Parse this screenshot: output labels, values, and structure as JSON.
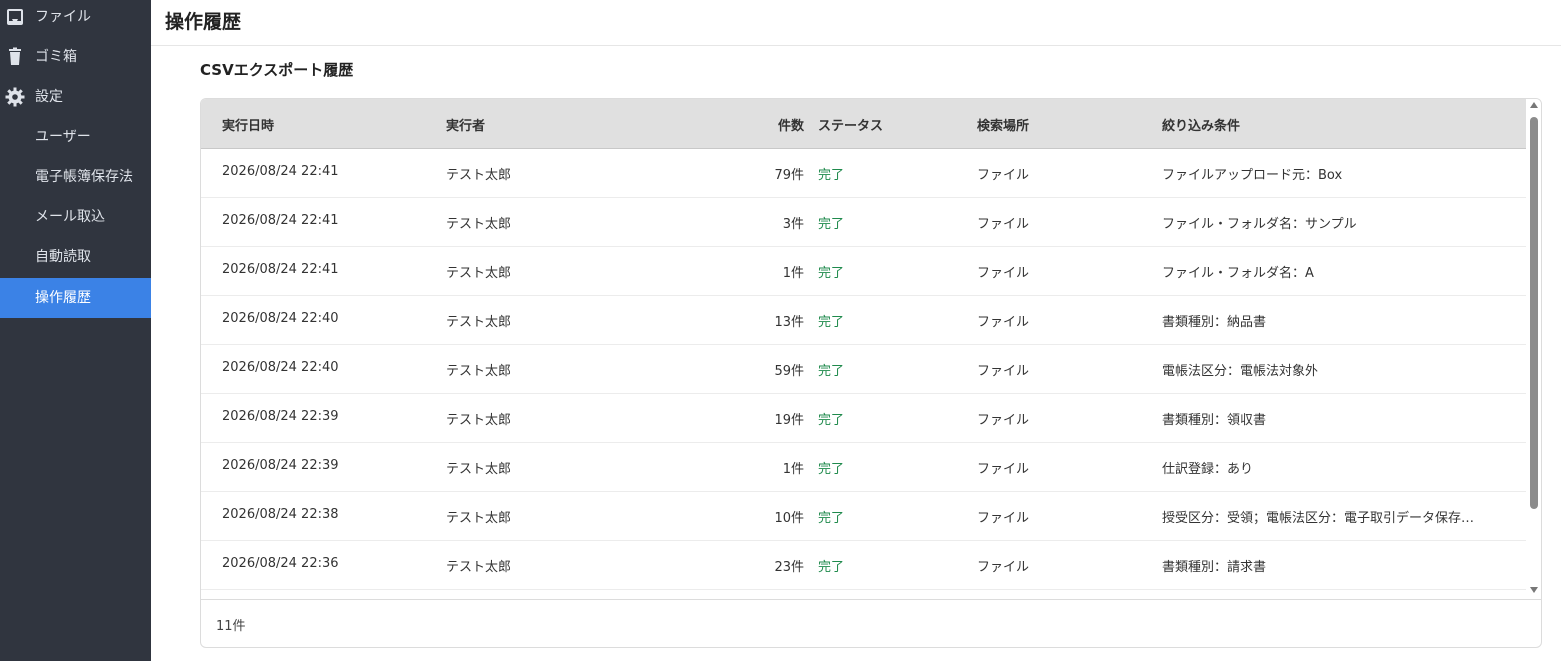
{
  "sidebar": {
    "items": [
      {
        "label": "ファイル",
        "icon": "inbox-icon"
      },
      {
        "label": "ゴミ箱",
        "icon": "trash-icon"
      },
      {
        "label": "設定",
        "icon": "gear-icon"
      },
      {
        "label": "ユーザー"
      },
      {
        "label": "電子帳簿保存法"
      },
      {
        "label": "メール取込"
      },
      {
        "label": "自動読取"
      },
      {
        "label": "操作履歴",
        "active": true
      }
    ],
    "active_color": "#3b82e6",
    "background": "#30353f"
  },
  "header": {
    "title": "操作履歴"
  },
  "main": {
    "section_title": "CSVエクスポート履歴",
    "table": {
      "columns": [
        "実行日時",
        "実行者",
        "件数",
        "ステータス",
        "検索場所",
        "絞り込み条件"
      ],
      "rows": [
        {
          "date": "2026/08/24 22:41",
          "user": "テスト太郎",
          "count": "79件",
          "status": "完了",
          "location": "ファイル",
          "condition": "ファイルアップロード元：Box"
        },
        {
          "date": "2026/08/24 22:41",
          "user": "テスト太郎",
          "count": "3件",
          "status": "完了",
          "location": "ファイル",
          "condition": "ファイル・フォルダ名：サンプル"
        },
        {
          "date": "2026/08/24 22:41",
          "user": "テスト太郎",
          "count": "1件",
          "status": "完了",
          "location": "ファイル",
          "condition": "ファイル・フォルダ名：A"
        },
        {
          "date": "2026/08/24 22:40",
          "user": "テスト太郎",
          "count": "13件",
          "status": "完了",
          "location": "ファイル",
          "condition": "書類種別：納品書"
        },
        {
          "date": "2026/08/24 22:40",
          "user": "テスト太郎",
          "count": "59件",
          "status": "完了",
          "location": "ファイル",
          "condition": "電帳法区分：電帳法対象外"
        },
        {
          "date": "2026/08/24 22:39",
          "user": "テスト太郎",
          "count": "19件",
          "status": "完了",
          "location": "ファイル",
          "condition": "書類種別：領収書"
        },
        {
          "date": "2026/08/24 22:39",
          "user": "テスト太郎",
          "count": "1件",
          "status": "完了",
          "location": "ファイル",
          "condition": "仕訳登録：あり"
        },
        {
          "date": "2026/08/24 22:38",
          "user": "テスト太郎",
          "count": "10件",
          "status": "完了",
          "location": "ファイル",
          "condition": "授受区分：受領；電帳法区分：電子取引データ保存…"
        },
        {
          "date": "2026/08/24 22:36",
          "user": "テスト太郎",
          "count": "23件",
          "status": "完了",
          "location": "ファイル",
          "condition": "書類種別：請求書"
        }
      ],
      "total": "11件",
      "status_color": "#1f8a4c"
    }
  }
}
